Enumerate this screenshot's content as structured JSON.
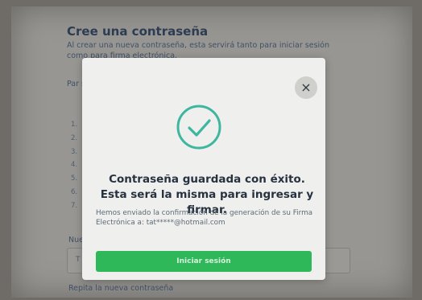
{
  "background": {
    "title": "Cree una contraseña",
    "intro": "Al crear una nueva contraseña, esta servirá tanto para iniciar sesión como para firma electrónica.",
    "paragraph_fragment": "Par seg",
    "rules": [
      "1.",
      "2.",
      "3.",
      "4.",
      "5.",
      "6.",
      "7."
    ],
    "new_password_label": "Nue",
    "new_password_placeholder": "T",
    "repeat_password_label": "Repita la nueva contraseña"
  },
  "modal": {
    "close_symbol": "×",
    "title": "Contraseña guardada con éxito. Esta será la misma para ingresar y firmar.",
    "message": "Hemos enviado la confirmación de la generación de su Firma Electrónica a: tat*****@hotmail.com",
    "button_label": "Iniciar sesión",
    "icon": "check-circle-icon"
  },
  "colors": {
    "accent_green": "#2fb85a",
    "check_teal": "#3eb6a0",
    "title_navy": "#2f4766"
  }
}
